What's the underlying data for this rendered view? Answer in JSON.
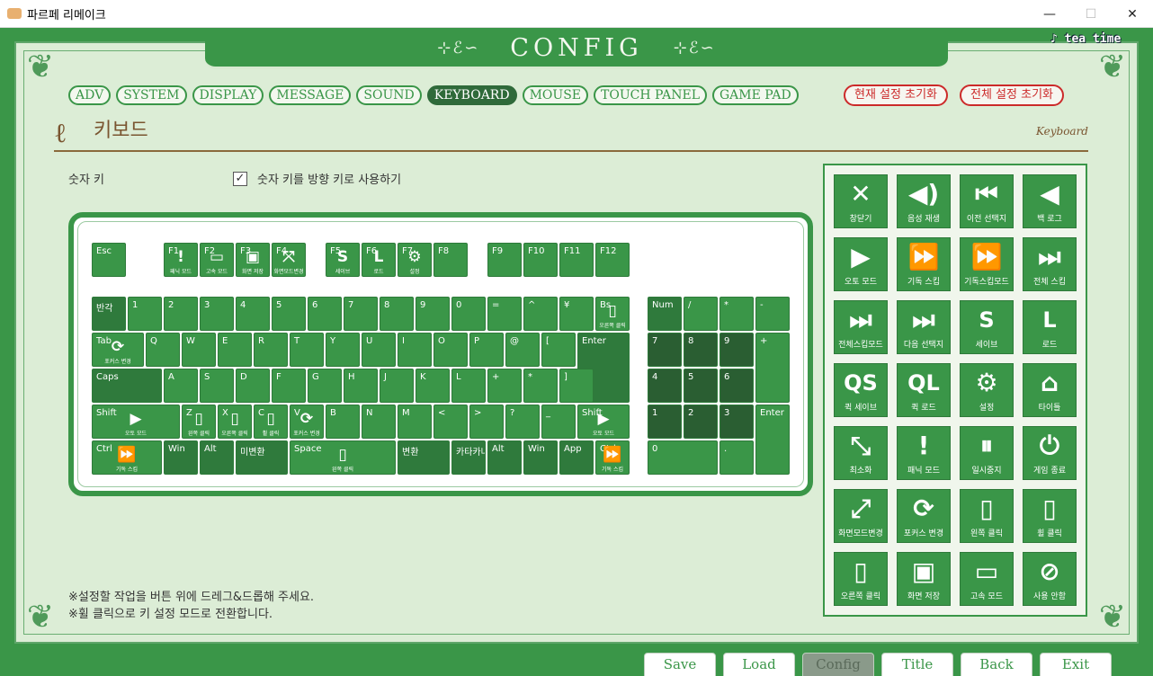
{
  "window": {
    "title": "파르페 리메이크",
    "min": "—",
    "max": "☐",
    "close": "✕"
  },
  "config_title": "CONFIG",
  "banner_deco": "⊹ℰ∽",
  "logo": "♪ tea time",
  "tabs": [
    "ADV",
    "SYSTEM",
    "DISPLAY",
    "MESSAGE",
    "SOUND",
    "KEYBOARD",
    "MOUSE",
    "TOUCH PANEL",
    "GAME PAD"
  ],
  "reset": {
    "current": "현재 설정 초기화",
    "all": "전체 설정 초기화"
  },
  "section": {
    "title": "키보드",
    "english": "Keyboard",
    "ornament": "ℓ"
  },
  "numkey": {
    "label": "숫자 키",
    "checkbox_label": "숫자 키를 방향 키로 사용하기",
    "checked": true,
    "check_mark": "✓"
  },
  "keys": {
    "esc": "Esc",
    "f1": "F1",
    "f2": "F2",
    "f3": "F3",
    "f4": "F4",
    "f5": "F5",
    "f6": "F6",
    "f7": "F7",
    "f8": "F8",
    "f9": "F9",
    "f10": "F10",
    "f11": "F11",
    "f12": "F12",
    "hankaku": "반각",
    "d1": "1",
    "d2": "2",
    "d3": "3",
    "d4": "4",
    "d5": "5",
    "d6": "6",
    "d7": "7",
    "d8": "8",
    "d9": "9",
    "d0": "0",
    "eq": "=",
    "caret": "^",
    "yen": "¥",
    "bs": "Bs",
    "tab": "Tab",
    "q": "Q",
    "w": "W",
    "e": "E",
    "r": "R",
    "t": "T",
    "y": "Y",
    "u": "U",
    "i": "I",
    "o": "O",
    "p": "P",
    "at": "@",
    "lbr": "[",
    "enter": "Enter",
    "caps": "Caps",
    "a": "A",
    "s": "S",
    "d": "D",
    "f": "F",
    "g": "G",
    "h": "H",
    "j": "J",
    "k": "K",
    "l": "L",
    "plus": "+",
    "star": "*",
    "rbr": "]",
    "shift": "Shift",
    "z": "Z",
    "x": "X",
    "c": "C",
    "v": "V",
    "b": "B",
    "n": "N",
    "m": "M",
    "lt": "<",
    "gt": ">",
    "qm": "?",
    "us": "_",
    "rshift": "Shift",
    "ctrl": "Ctrl",
    "win": "Win",
    "alt": "Alt",
    "muhenkan": "미변환",
    "space": "Space",
    "henkan": "변환",
    "katakana": "카타카나",
    "ralt": "Alt",
    "rwin": "Win",
    "app": "App",
    "rctrl": "Ctrl",
    "num": "Num",
    "nslash": "/",
    "nstar": "*",
    "nminus": "-",
    "n7": "7",
    "n8": "8",
    "n9": "9",
    "nplus": "+",
    "n4": "4",
    "n5": "5",
    "n6": "6",
    "n1": "1",
    "n2": "2",
    "n3": "3",
    "nenter": "Enter",
    "n0": "0",
    "ndot": "."
  },
  "key_subs": {
    "f1": "패닉 모드",
    "f2": "고속 모드",
    "f3": "화면 저장",
    "f4": "화면모드변경",
    "f5": "세이브",
    "f6": "로드",
    "f7": "설정",
    "bs": "오른쪽 클릭",
    "tab": "포커스 변경",
    "shift": "오토 모드",
    "z": "왼쪽 클릭",
    "x": "오른쪽 클릭",
    "c": "휠 클릭",
    "v": "포커스 변경",
    "rshift": "오토 모드",
    "ctrl": "기독 스킵",
    "space": "왼쪽 클릭",
    "rctrl": "기독 스킵"
  },
  "key_icons": {
    "play": "▶",
    "ffwd": "⏩",
    "refresh": "⟳",
    "camera": "▣",
    "expand": "⤧",
    "exclaim": "!",
    "gear": "⚙",
    "mouse": "▯",
    "fast": "▭",
    "s": "S",
    "l": "L"
  },
  "actions": [
    {
      "icon": "✕",
      "label": "창닫기"
    },
    {
      "icon": "◀)",
      "label": "음성 재생"
    },
    {
      "icon": "⏮",
      "label": "이전 선택지"
    },
    {
      "icon": "◀",
      "label": "백 로그"
    },
    {
      "icon": "▶",
      "label": "오토 모드"
    },
    {
      "icon": "⏩",
      "label": "기독 스킵"
    },
    {
      "icon": "⏩",
      "label": "기독스킵모드"
    },
    {
      "icon": "⏭",
      "label": "전체 스킵"
    },
    {
      "icon": "⏭",
      "label": "전체스킵모드"
    },
    {
      "icon": "⏭",
      "label": "다음 선택지"
    },
    {
      "icon": "S",
      "label": "세이브"
    },
    {
      "icon": "L",
      "label": "로드"
    },
    {
      "icon": "QS",
      "label": "퀵 세이브"
    },
    {
      "icon": "QL",
      "label": "퀵 로드"
    },
    {
      "icon": "⚙",
      "label": "설정"
    },
    {
      "icon": "⌂",
      "label": "타이틀"
    },
    {
      "icon": "⤡",
      "label": "최소화"
    },
    {
      "icon": "!",
      "label": "패닉 모드"
    },
    {
      "icon": "⏸",
      "label": "일시중지"
    },
    {
      "icon": "⏻",
      "label": "게임 종료"
    },
    {
      "icon": "⤢",
      "label": "화면모드변경"
    },
    {
      "icon": "⟳",
      "label": "포커스 변경"
    },
    {
      "icon": "▯",
      "label": "왼쪽 클릭"
    },
    {
      "icon": "▯",
      "label": "휠 클릭"
    },
    {
      "icon": "▯",
      "label": "오른쪽 클릭"
    },
    {
      "icon": "▣",
      "label": "화면 저장"
    },
    {
      "icon": "▭",
      "label": "고속 모드"
    },
    {
      "icon": "⊘",
      "label": "사용 안함"
    }
  ],
  "notes": [
    "※설정할 작업을 버튼 위에 드레그&드롭해 주세요.",
    "※휠 클릭으로 키 설정 모드로 전환합니다."
  ],
  "bottom_nav": [
    "Save",
    "Load",
    "Config",
    "Title",
    "Back",
    "Exit"
  ],
  "colors": {
    "accent": "#3a9648",
    "dark": "#2a5e32",
    "paper": "#dcedd6",
    "reset": "#cc2a2a",
    "brown": "#7a5530"
  }
}
